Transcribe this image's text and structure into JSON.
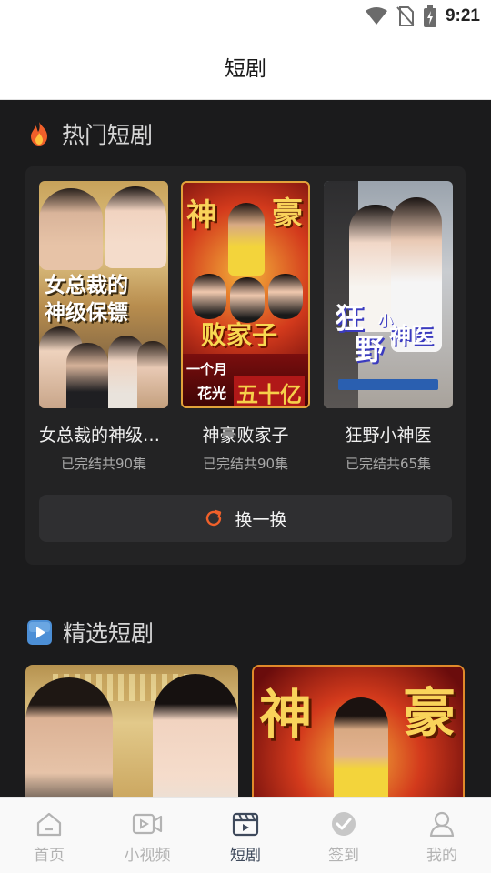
{
  "status_bar": {
    "time": "9:21"
  },
  "header": {
    "title": "短剧"
  },
  "hot_section": {
    "title": "热门短剧",
    "dramas": [
      {
        "name": "女总裁的神级保镖",
        "status": "已完结共90集",
        "poster_line1": "女总裁的",
        "poster_line2": "神级保镖"
      },
      {
        "name": "神豪败家子",
        "status": "已完结共90集",
        "poster_top_left": "神",
        "poster_top_right": "豪",
        "poster_middle": "败家子",
        "poster_bottom_left": "一个月",
        "poster_bottom_small": "花光",
        "poster_bottom_big": "五十亿"
      },
      {
        "name": "狂野小神医",
        "status": "已完结共65集",
        "poster_title_a": "狂",
        "poster_title_b": "野",
        "poster_title_c": "小",
        "poster_title_d": "神医"
      }
    ],
    "refresh_label": "换一换"
  },
  "featured_section": {
    "title": "精选短剧",
    "poster2_left": "神",
    "poster2_right": "豪"
  },
  "bottom_nav": {
    "items": [
      {
        "label": "首页",
        "icon": "home-icon",
        "active": false
      },
      {
        "label": "小视频",
        "icon": "video-icon",
        "active": false
      },
      {
        "label": "短剧",
        "icon": "film-icon",
        "active": true
      },
      {
        "label": "签到",
        "icon": "checkin-icon",
        "active": false
      },
      {
        "label": "我的",
        "icon": "profile-icon",
        "active": false
      }
    ]
  },
  "colors": {
    "background": "#1b1b1c",
    "card": "#232324",
    "accent": "#f0602a",
    "nav_active": "#3f4a5c",
    "nav_inactive": "#b3b3b3"
  }
}
